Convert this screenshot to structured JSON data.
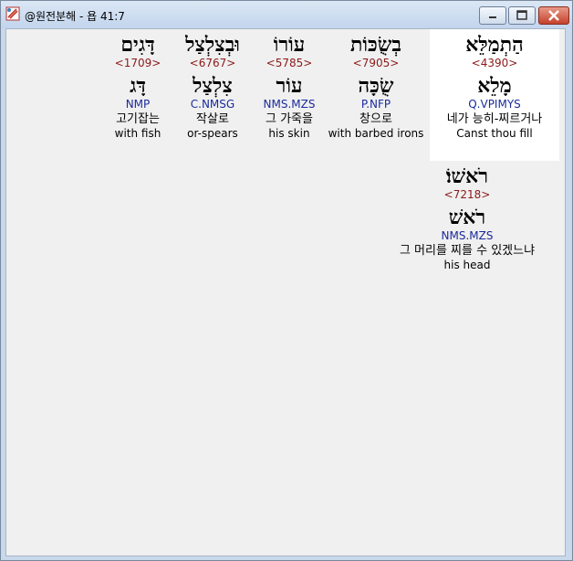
{
  "window": {
    "title": "@원전분해 - 욥 41:7",
    "controls": [
      "minimize",
      "maximize",
      "close"
    ]
  },
  "colors": {
    "strong_number": "#8b1a1a",
    "morphology": "#1a2a9c",
    "selected_cell": "#ffffff"
  },
  "words": [
    {
      "hebrew": "הַתְמַלֵּא",
      "strong": "<4390>",
      "lemma": "מָלֵא",
      "morph": "Q.VPIMYS",
      "korean": "네가 능히-찌르거나",
      "english": "Canst thou fill",
      "selected": true
    },
    {
      "hebrew": "בְשֻׂכּוֹת",
      "strong": "<7905>",
      "lemma": "שֻׂכָּה",
      "morph": "P.NFP",
      "korean": "창으로",
      "english": "with barbed irons",
      "selected": false
    },
    {
      "hebrew": "עוֹרוֹ",
      "strong": "<5785>",
      "lemma": "עוֹר",
      "morph": "NMS.MZS",
      "korean": "그 가죽을",
      "english": "his skin",
      "selected": false
    },
    {
      "hebrew": "וּבְצִלְצַל",
      "strong": "<6767>",
      "lemma": "צִלְצַל",
      "morph": "C.NMSG",
      "korean": "작살로",
      "english": "or-spears",
      "selected": false
    },
    {
      "hebrew": "דָּגִים",
      "strong": "<1709>",
      "lemma": "דָּג",
      "morph": "NMP",
      "korean": "고기잡는",
      "english": "with fish",
      "selected": false
    },
    {
      "hebrew": "רֹאשׁוֹ׃",
      "strong": "<7218>",
      "lemma": "רֹאשׁ",
      "morph": "NMS.MZS",
      "korean": "그 머리를 찌를 수 있겠느냐",
      "english": "his head",
      "selected": false
    }
  ]
}
